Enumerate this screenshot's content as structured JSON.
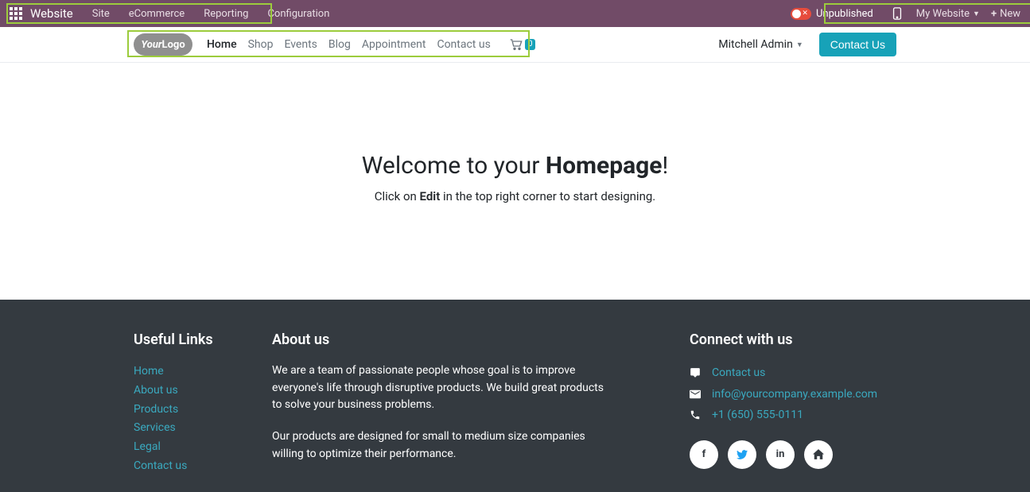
{
  "editor": {
    "main": "Website",
    "menu": [
      "Site",
      "eCommerce",
      "Reporting",
      "Configuration"
    ],
    "publish_state": "Unpublished",
    "site_selector": "My Website",
    "new_label": "New"
  },
  "header": {
    "logo_text": "YourLogo",
    "nav": [
      {
        "label": "Home",
        "active": true
      },
      {
        "label": "Shop",
        "active": false
      },
      {
        "label": "Events",
        "active": false
      },
      {
        "label": "Blog",
        "active": false
      },
      {
        "label": "Appointment",
        "active": false
      },
      {
        "label": "Contact us",
        "active": false
      }
    ],
    "cart_count": "0",
    "user": "Mitchell Admin",
    "contact_button": "Contact Us"
  },
  "hero": {
    "title_pre": "Welcome to your ",
    "title_bold": "Homepage",
    "title_post": "!",
    "sub_pre": "Click on ",
    "sub_bold": "Edit",
    "sub_post": " in the top right corner to start designing."
  },
  "footer": {
    "links_title": "Useful Links",
    "links": [
      "Home",
      "About us",
      "Products",
      "Services",
      "Legal",
      "Contact us"
    ],
    "about_title": "About us",
    "about_p1": "We are a team of passionate people whose goal is to improve everyone's life through disruptive products. We build great products to solve your business problems.",
    "about_p2": "Our products are designed for small to medium size companies willing to optimize their performance.",
    "connect_title": "Connect with us",
    "contact_link": "Contact us",
    "email": "info@yourcompany.example.com",
    "phone": "+1 (650) 555-0111"
  }
}
